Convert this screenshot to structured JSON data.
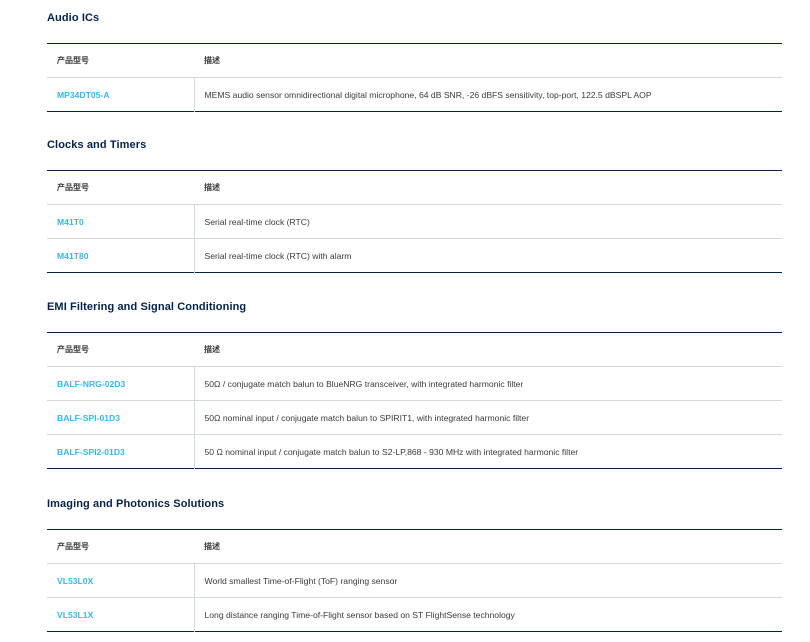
{
  "sections": [
    {
      "title": "Audio ICs",
      "header": {
        "part": "产品型号",
        "description": "描述"
      },
      "rows": [
        {
          "part": "MP34DT05-A",
          "description": "MEMS audio sensor omnidirectional digital microphone, 64 dB SNR, -26 dBFS sensitivity, top-port, 122.5 dBSPL AOP"
        }
      ]
    },
    {
      "title": "Clocks and Timers",
      "header": {
        "part": "产品型号",
        "description": "描述"
      },
      "rows": [
        {
          "part": "M41T0",
          "description": "Serial real-time clock (RTC)"
        },
        {
          "part": "M41T80",
          "description": "Serial real-time clock (RTC) with alarm"
        }
      ]
    },
    {
      "title": "EMI Filtering and Signal Conditioning",
      "header": {
        "part": "产品型号",
        "description": "描述"
      },
      "rows": [
        {
          "part": "BALF-NRG-02D3",
          "description": "50Ω / conjugate match balun to BlueNRG transceiver, with integrated harmonic filter"
        },
        {
          "part": "BALF-SPI-01D3",
          "description": "50Ω nominal input / conjugate match balun to SPIRIT1, with integrated harmonic filter"
        },
        {
          "part": "BALF-SPI2-01D3",
          "description": "50 Ω nominal input / conjugate match balun to S2-LP,868 - 930 MHz with integrated harmonic filter"
        }
      ]
    },
    {
      "title": "Imaging and Photonics Solutions",
      "header": {
        "part": "产品型号",
        "description": "描述"
      },
      "rows": [
        {
          "part": "VL53L0X",
          "description": "World smallest Time-of-Flight (ToF) ranging sensor"
        },
        {
          "part": "VL53L1X",
          "description": "Long distance ranging Time-of-Flight sensor based on ST FlightSense technology"
        }
      ]
    }
  ]
}
